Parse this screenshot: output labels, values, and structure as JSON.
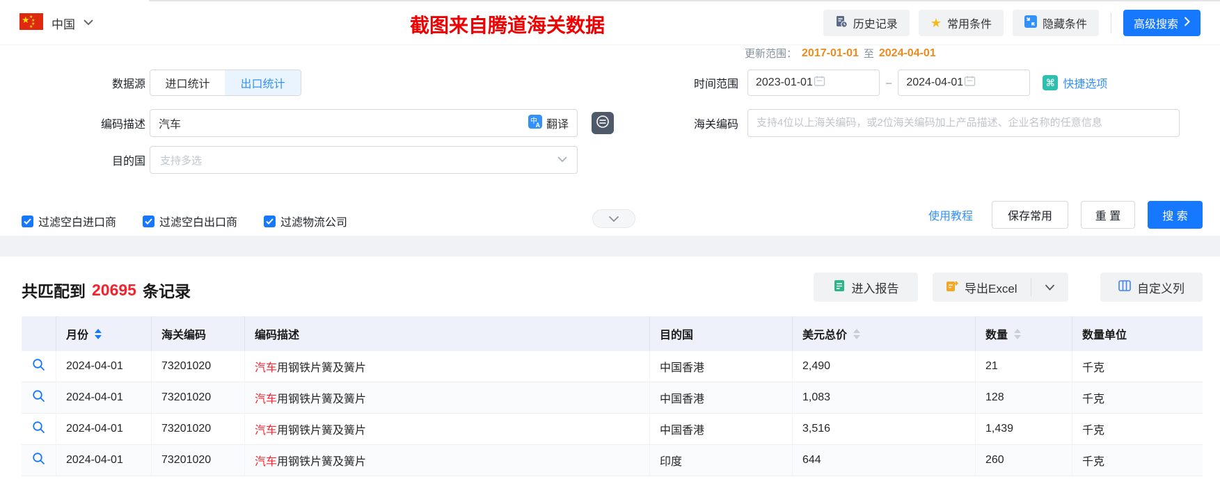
{
  "topbar": {
    "country": "中国",
    "watermark": "截图来自腾道海关数据",
    "history_btn": "历史记录",
    "favorite_btn": "常用条件",
    "hide_btn": "隐藏条件",
    "advanced_btn": "高级搜索"
  },
  "form": {
    "datasource_label": "数据源",
    "tab_import": "进口统计",
    "tab_export": "出口统计",
    "code_desc_label": "编码描述",
    "code_desc_value": "汽车",
    "translate_label": "翻译",
    "dest_label": "目的国",
    "dest_placeholder": "支持多选",
    "update_label": "更新范围：",
    "update_from": "2017-01-01",
    "update_to_word": "至",
    "update_to": "2024-04-01",
    "time_label": "时间范围",
    "time_start": "2023-01-01",
    "time_separator": "–",
    "time_end": "2024-04-01",
    "quick_option": "快捷选项",
    "hs_label": "海关编码",
    "hs_placeholder": "支持4位以上海关编码，或2位海关编码加上产品描述、企业名称的任意信息",
    "checkbox_import": "过滤空白进口商",
    "checkbox_export": "过滤空白出口商",
    "checkbox_logistics": "过滤物流公司",
    "tutorial_link": "使用教程",
    "save_btn": "保存常用",
    "reset_btn": "重 置",
    "search_btn": "搜 索"
  },
  "results": {
    "summary_prefix": "共匹配到",
    "summary_count": "20695",
    "summary_suffix": "条记录",
    "report_btn": "进入报告",
    "export_btn": "导出Excel",
    "custom_col_btn": "自定义列",
    "table": {
      "headers": {
        "month": "月份",
        "hs_code": "海关编码",
        "desc": "编码描述",
        "dest": "目的国",
        "usd": "美元总价",
        "qty": "数量",
        "unit": "数量单位"
      },
      "rows": [
        {
          "month": "2024-04-01",
          "hs_code": "73201020",
          "desc_hl": "汽车",
          "desc_rest": "用钢铁片簧及簧片",
          "dest": "中国香港",
          "usd": "2,490",
          "qty": "21",
          "unit": "千克"
        },
        {
          "month": "2024-04-01",
          "hs_code": "73201020",
          "desc_hl": "汽车",
          "desc_rest": "用钢铁片簧及簧片",
          "dest": "中国香港",
          "usd": "1,083",
          "qty": "128",
          "unit": "千克"
        },
        {
          "month": "2024-04-01",
          "hs_code": "73201020",
          "desc_hl": "汽车",
          "desc_rest": "用钢铁片簧及簧片",
          "dest": "中国香港",
          "usd": "3,516",
          "qty": "1,439",
          "unit": "千克"
        },
        {
          "month": "2024-04-01",
          "hs_code": "73201020",
          "desc_hl": "汽车",
          "desc_rest": "用钢铁片簧及簧片",
          "dest": "印度",
          "usd": "644",
          "qty": "260",
          "unit": "千克"
        }
      ]
    }
  },
  "colors": {
    "primary_blue": "#1677ff",
    "link_blue": "#3491fa",
    "orange": "#ef8a1d",
    "red": "#f5222d",
    "title_red": "#ef0000",
    "header_bg": "#eef1f9",
    "band_gray": "#f0f2f5"
  }
}
